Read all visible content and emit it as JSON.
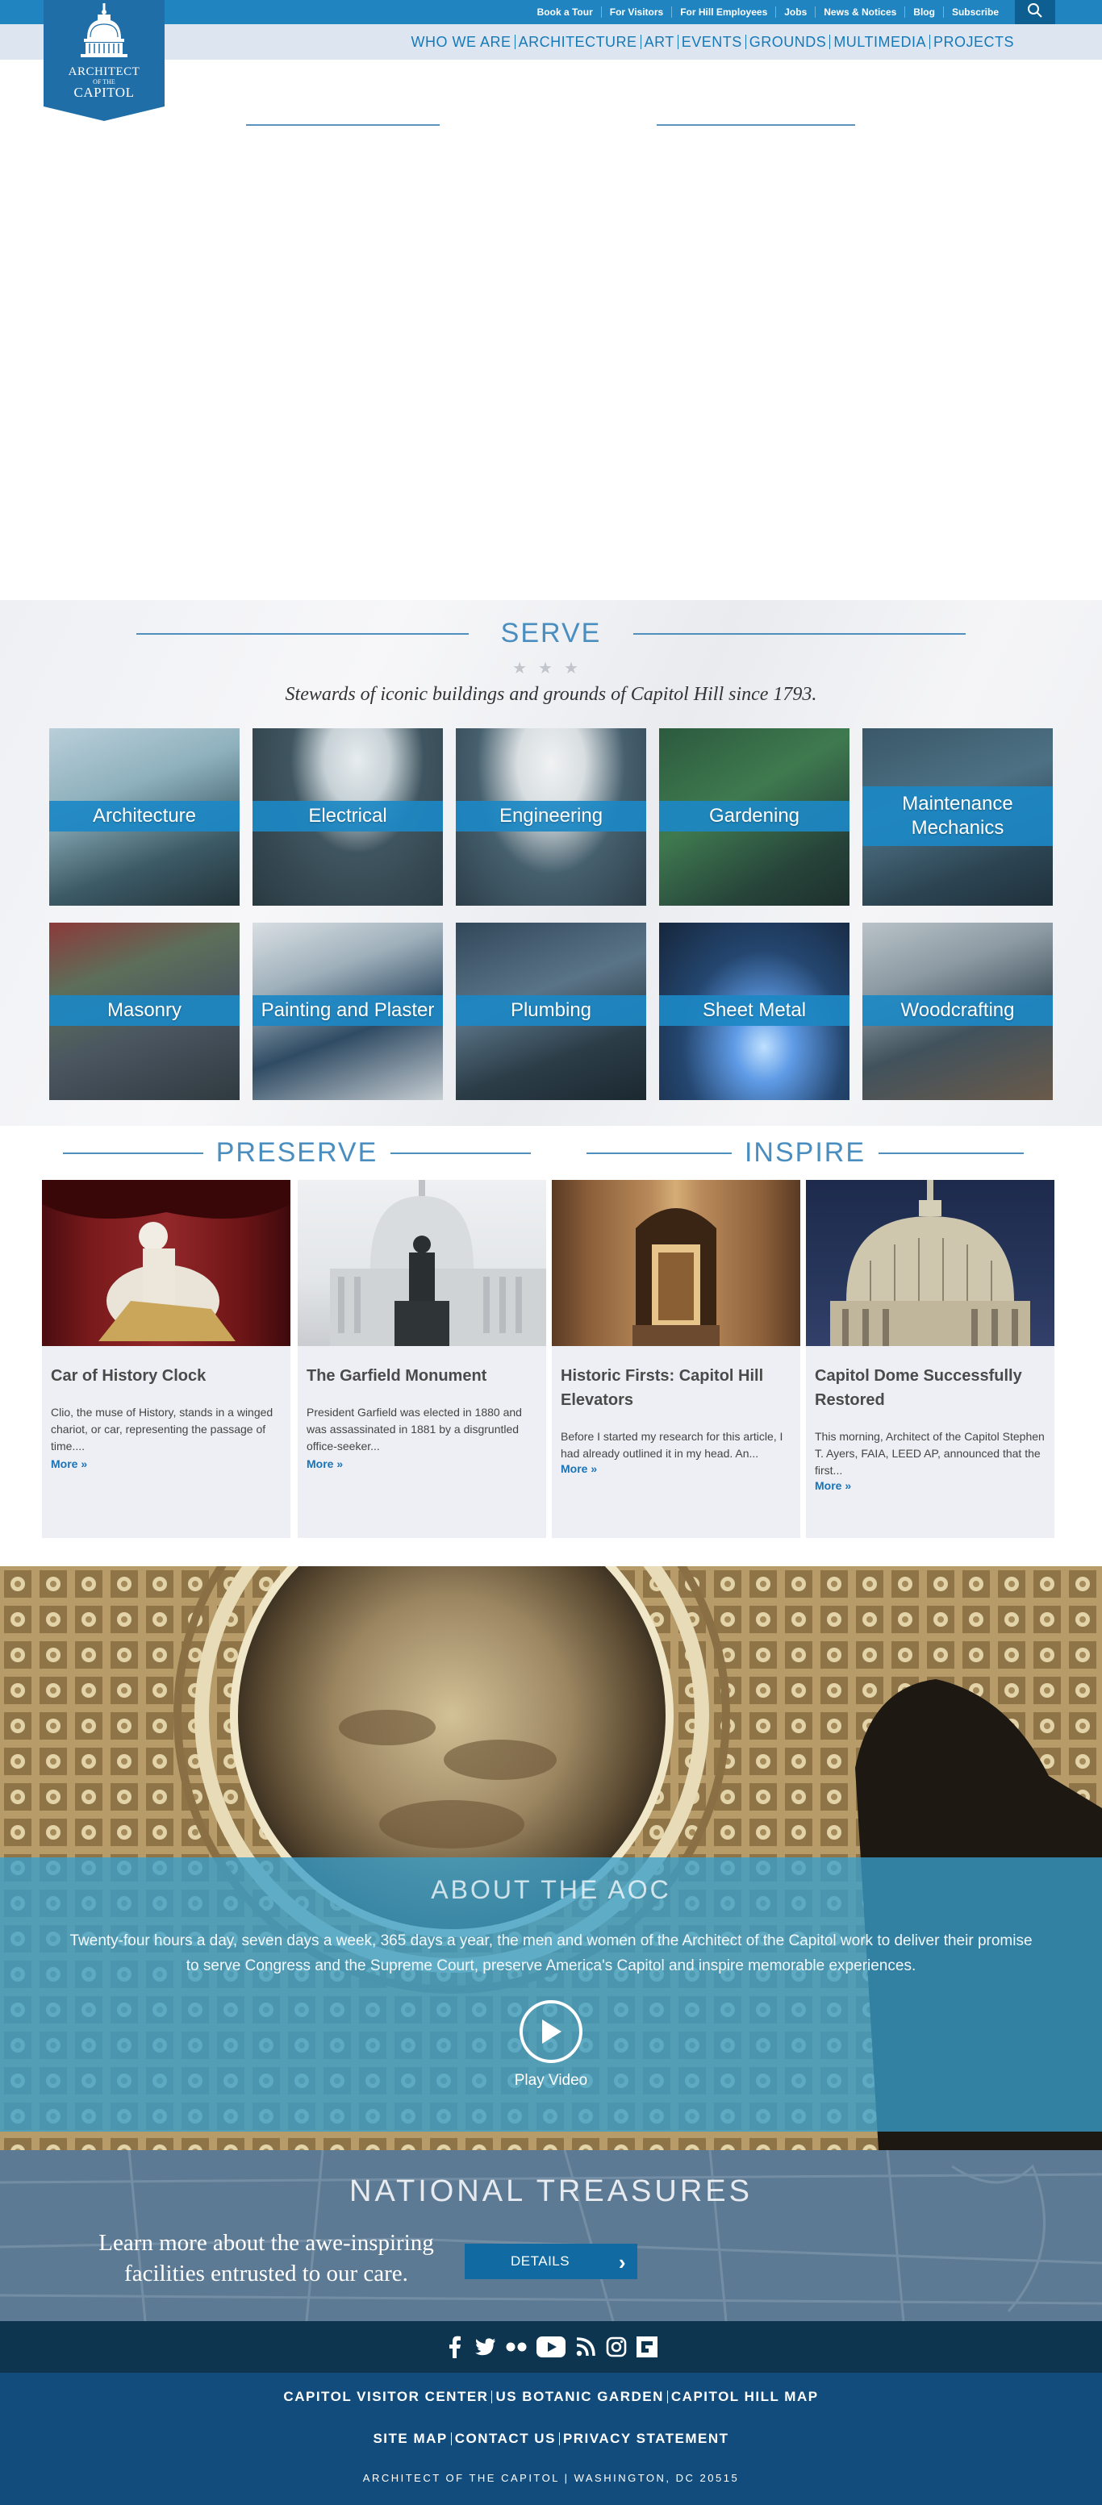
{
  "logo": {
    "line1": "ARCHITECT",
    "line2": "OF THE",
    "line3": "CAPITOL"
  },
  "utility_links": [
    "Book a Tour",
    "For Visitors",
    "For Hill Employees",
    "Jobs",
    "News & Notices",
    "Blog",
    "Subscribe"
  ],
  "search": {
    "icon": "search-icon"
  },
  "nav": [
    "WHO WE ARE",
    "ARCHITECTURE",
    "ART",
    "EVENTS",
    "GROUNDS",
    "MULTIMEDIA",
    "PROJECTS"
  ],
  "serve": {
    "title": "SERVE",
    "stars": "★★★",
    "tagline": "Stewards of iconic buildings and grounds of Capitol Hill since 1793.",
    "trades": [
      "Architecture",
      "Electrical",
      "Engineering",
      "Gardening",
      "Maintenance Mechanics",
      "Masonry",
      "Painting and Plaster",
      "Plumbing",
      "Sheet Metal",
      "Woodcrafting"
    ]
  },
  "preserve": {
    "title": "PRESERVE"
  },
  "inspire": {
    "title": "INSPIRE"
  },
  "cards": [
    {
      "title": "Car of History Clock",
      "text": "Clio, the muse of History, stands in a winged chariot, or car, representing the passage of time....",
      "more": "More »"
    },
    {
      "title": "The Garfield Monument",
      "text": "President Garfield was elected in 1880 and was assassinated in 1881 by a disgruntled office-seeker...",
      "more": "More »"
    },
    {
      "title": "Historic Firsts: Capitol Hill Elevators",
      "text": "Before I started my research for this article, I had already outlined it in my head. An...",
      "more": "More »"
    },
    {
      "title": "Capitol Dome Successfully Restored",
      "text": "This morning, Architect of the Capitol Stephen T. Ayers, FAIA, LEED AP, announced that the first...",
      "more": "More »"
    }
  ],
  "about": {
    "title": "ABOUT THE AOC",
    "text": "Twenty-four hours a day, seven days a week, 365 days a year, the men and women of the Architect of the Capitol work to deliver their promise to serve Congress and the Supreme Court, preserve America's Capitol and inspire memorable experiences.",
    "play_label": "Play Video"
  },
  "treasures": {
    "title": "NATIONAL TREASURES",
    "text": "Learn more about the awe-inspiring facilities entrusted to our care.",
    "button": "DETAILS"
  },
  "social": [
    "facebook-icon",
    "twitter-icon",
    "flickr-icon",
    "youtube-icon",
    "rss-icon",
    "instagram-icon",
    "flipboard-icon"
  ],
  "footer": {
    "row1": [
      "CAPITOL VISITOR CENTER",
      "US BOTANIC GARDEN",
      "CAPITOL HILL MAP"
    ],
    "row2": [
      "SITE MAP",
      "CONTACT US",
      "PRIVACY STATEMENT"
    ],
    "copyright": "ARCHITECT OF THE CAPITOL | WASHINGTON, DC 20515"
  },
  "colors": {
    "primary": "#1f84c0",
    "nav_bg": "#dde6f0",
    "footer": "#124c7c",
    "social_bar": "#0d3550",
    "about_overlay": "#389fca"
  }
}
